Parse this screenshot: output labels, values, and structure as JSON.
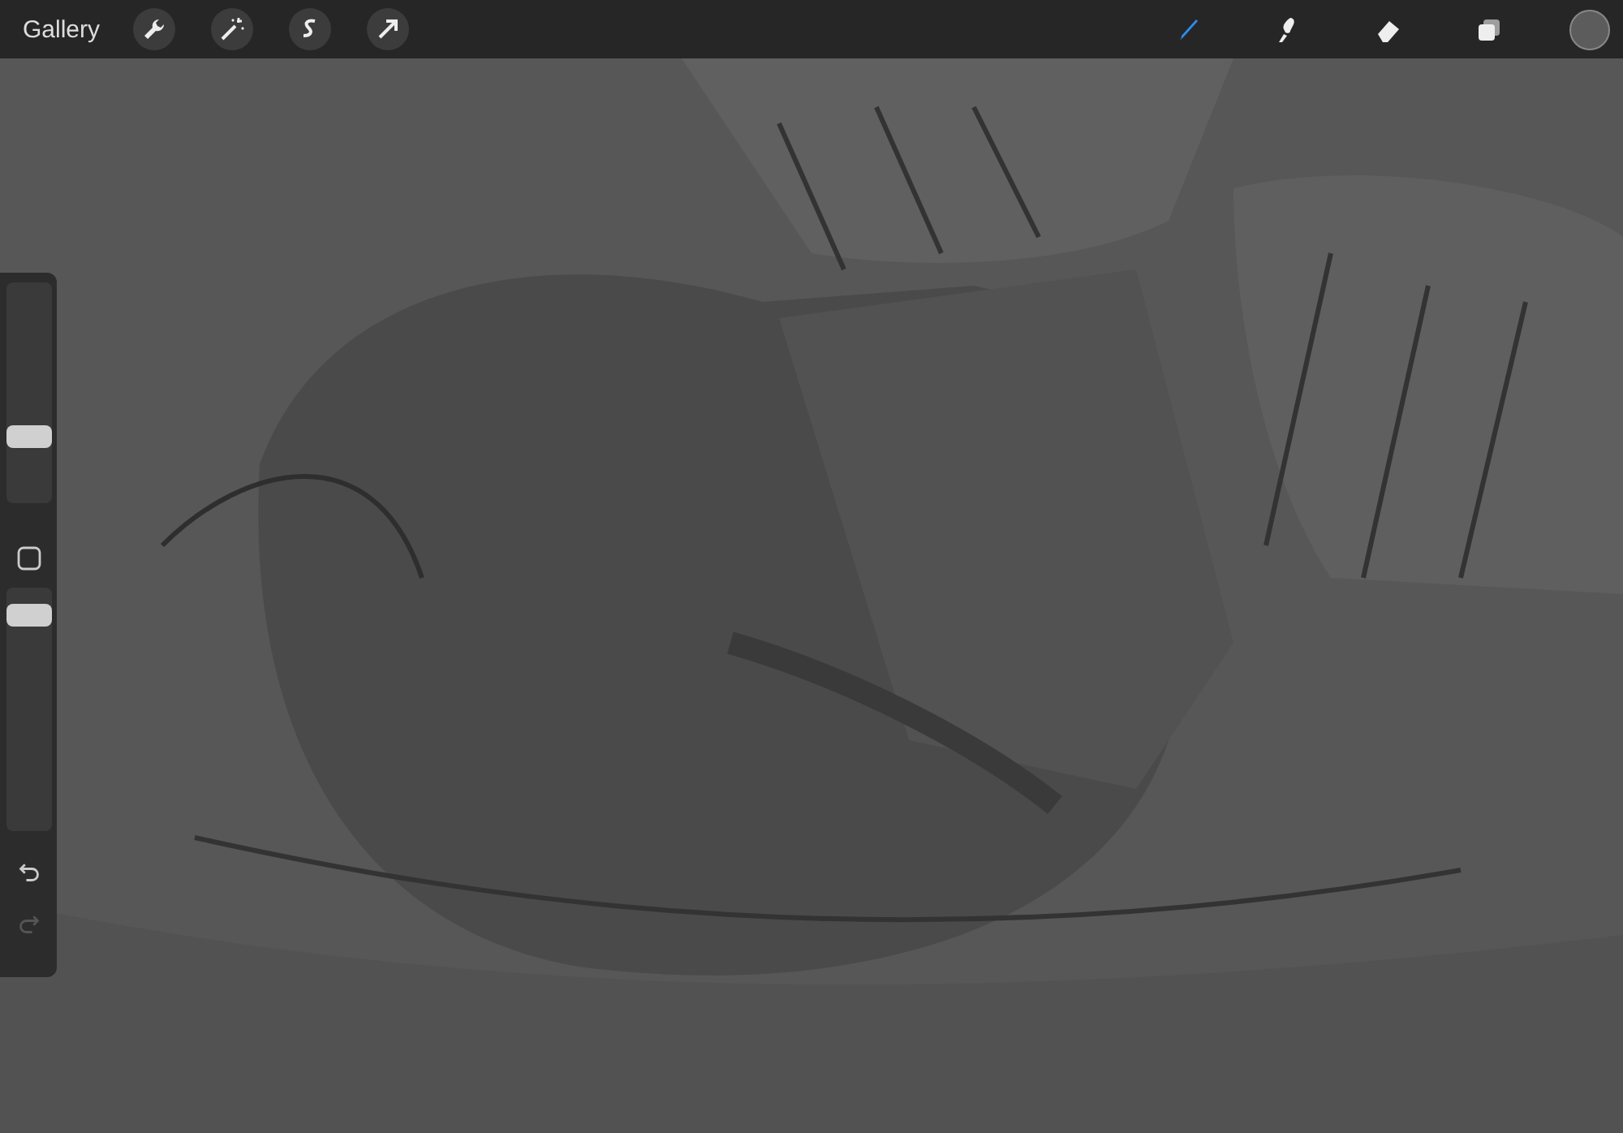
{
  "toolbar": {
    "gallery_label": "Gallery",
    "left_tools": [
      {
        "kind": "wrench",
        "selected": false
      },
      {
        "kind": "wand",
        "selected": false
      },
      {
        "kind": "selection",
        "selected": false
      },
      {
        "kind": "transform",
        "selected": false
      }
    ],
    "right_tools": [
      {
        "kind": "brush",
        "selected": true
      },
      {
        "kind": "smudge",
        "selected": false
      },
      {
        "kind": "eraser",
        "selected": false
      },
      {
        "kind": "layers",
        "selected": false
      }
    ]
  },
  "sidebar": {
    "size_slider": {
      "level": 0.3
    },
    "opacity_slider": {
      "level": 0.89
    },
    "undo": {
      "disabled": false
    },
    "redo": {
      "disabled": true
    }
  }
}
